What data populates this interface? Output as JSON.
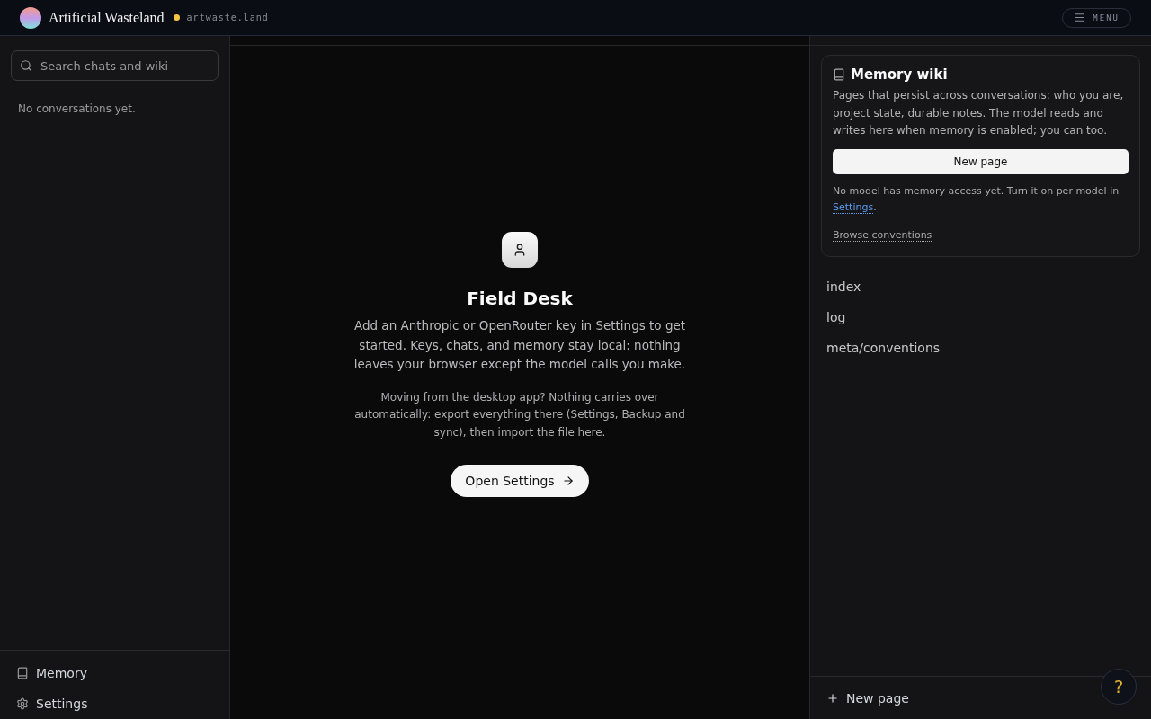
{
  "topbar": {
    "brand": "Artificial Wasteland",
    "status": {
      "color": "#f5c542"
    },
    "domain": "artwaste.land",
    "menu_label": "MENU"
  },
  "sidebar": {
    "search": {
      "placeholder": "Search chats and wiki"
    },
    "empty_text": "No conversations yet.",
    "footer_items": [
      {
        "kind": "memory",
        "label": "Memory"
      },
      {
        "kind": "settings",
        "label": "Settings"
      }
    ]
  },
  "main": {
    "title": "Field Desk",
    "intro": "Add an Anthropic or OpenRouter key in Settings to get started. Keys, chats, and memory stay local: nothing leaves your browser except the model calls you make.",
    "note": "Moving from the desktop app? Nothing carries over automatically: export everything there (Settings, Backup and sync), then import the file here.",
    "button": "Open Settings"
  },
  "wiki": {
    "title": "Memory wiki",
    "description": "Pages that persist across conversations: who you are, project state, durable notes. The model reads and writes here when memory is enabled; you can too.",
    "new_page_button": "New page",
    "notice": "No model has memory access yet. Turn it on per model in",
    "notice_link": "Settings",
    "notice_end": ".",
    "browse_link": "Browse conventions",
    "pages": [
      "index",
      "log",
      "meta/conventions"
    ],
    "footer_button": "New page"
  },
  "help_button": "?"
}
